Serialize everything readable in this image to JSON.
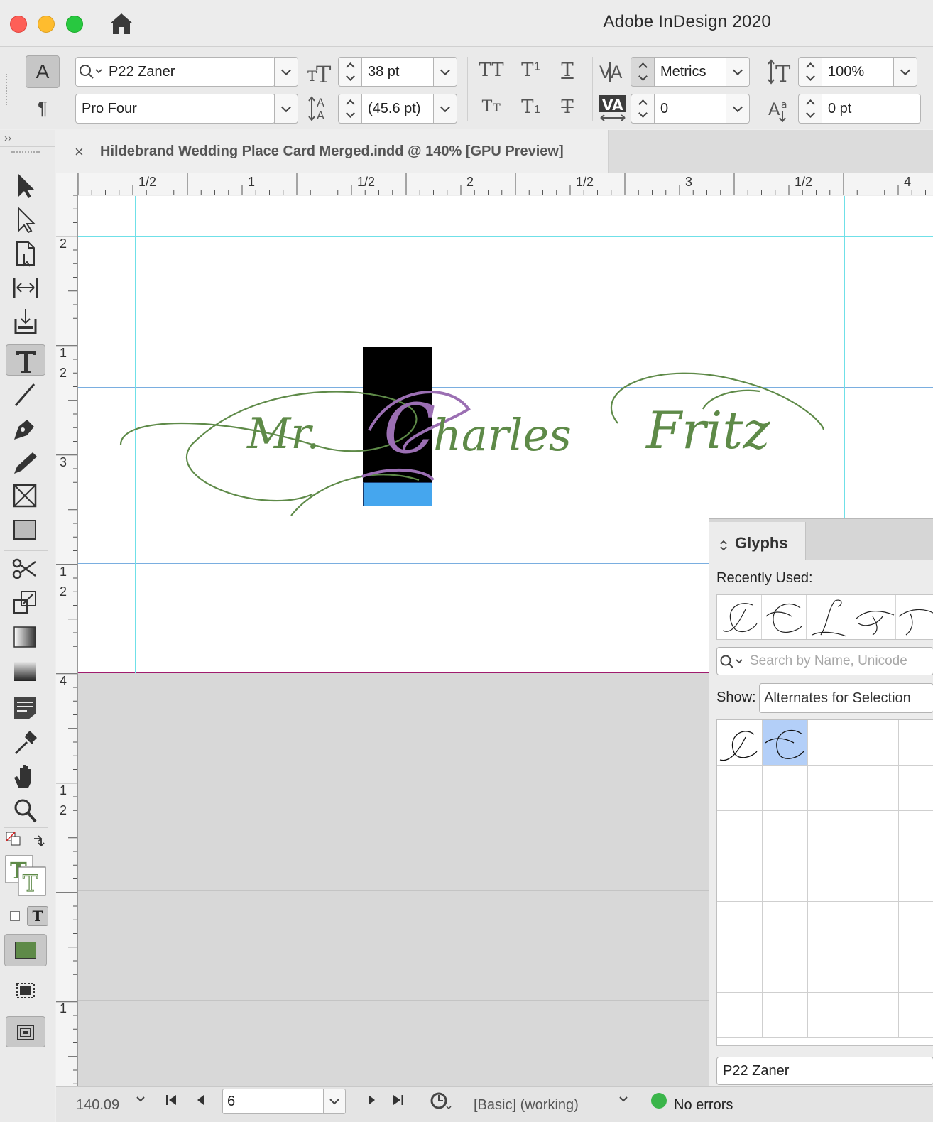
{
  "app": {
    "title": "Adobe InDesign 2020"
  },
  "control_panel": {
    "char_mode": "A",
    "para_mode": "¶",
    "font_family": "P22 Zaner",
    "font_style": "Pro Four",
    "font_size": "38 pt",
    "leading": "(45.6 pt)",
    "kerning": "Metrics",
    "tracking": "0",
    "vertical_scale": "100%",
    "baseline_shift": "0 pt"
  },
  "tools_panel": {
    "collapse": "››"
  },
  "document": {
    "tab_close": "×",
    "tab_title": "Hildebrand Wedding Place Card Merged.indd @ 140% [GPU Preview]",
    "text": {
      "prefix": "Mr.",
      "selected_glyph": "C",
      "rest": "harles",
      "last": "Fritz"
    },
    "colors": {
      "text_fill": "#5e8a48",
      "selection": "#000000",
      "glyph_highlight": "#9b6fb3"
    }
  },
  "ruler": {
    "h_labels": [
      "1/2",
      "1",
      "1/2",
      "2",
      "1/2",
      "3",
      "1/2",
      "4"
    ],
    "v_labels": [
      "2",
      "1",
      "2",
      "3",
      "1",
      "2",
      "4",
      "1",
      "2",
      "1"
    ]
  },
  "glyphs_panel": {
    "title": "Glyphs",
    "recently_used_label": "Recently Used:",
    "search_placeholder": "Search by Name, Unicode",
    "show_label": "Show:",
    "show_value": "Alternates for Selection",
    "font": "P22 Zaner"
  },
  "status_bar": {
    "zoom": "140.09",
    "page": "6",
    "profile": "[Basic] (working)",
    "preflight": "No errors"
  }
}
